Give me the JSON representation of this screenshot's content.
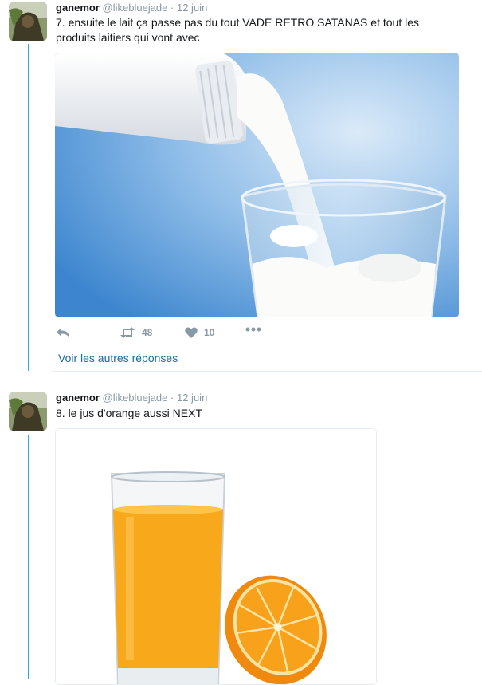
{
  "tweets": [
    {
      "name": "ganemor",
      "handle": "@likebluejade",
      "separator": "·",
      "date": "12 juin",
      "text": "7. ensuite le lait ça passe pas du tout VADE RETRO SATANAS et tout les produits laitiers qui vont avec",
      "retweets": "48",
      "likes": "10",
      "icons": [
        "reply-icon",
        "retweet-icon",
        "heart-icon",
        "more-icon"
      ]
    },
    {
      "name": "ganemor",
      "handle": "@likebluejade",
      "separator": "·",
      "date": "12 juin",
      "text": "8. le jus d'orange aussi NEXT"
    }
  ],
  "more_replies_label": "Voir les autres réponses",
  "colors": {
    "thread_line": "#2fa8df",
    "link": "#1b6aa5",
    "muted": "#8899a6"
  }
}
